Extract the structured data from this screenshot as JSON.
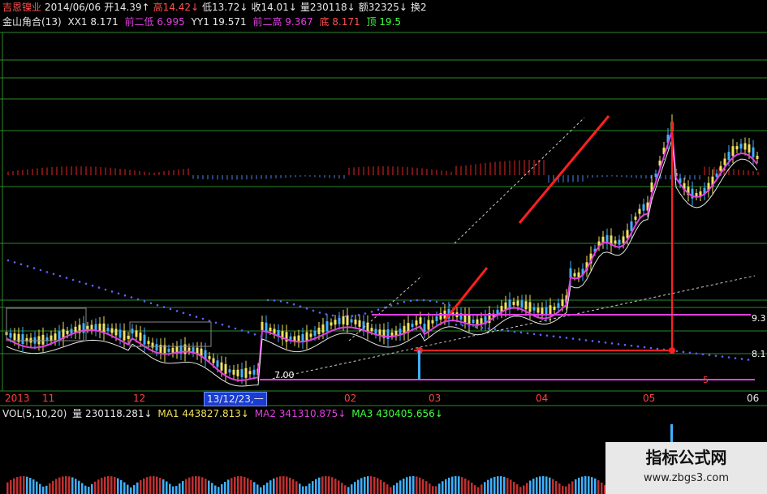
{
  "header": {
    "name": "吉恩镍业",
    "date": "2014/06/06",
    "open": "开14.39↑",
    "high": "高14.42↓",
    "low": "低13.72↓",
    "close": "收14.01↓",
    "volume": "量230118↓",
    "amount": "额32325↓",
    "turnover": "换2"
  },
  "indicator": {
    "name": "金山角合(13)",
    "xx1": "XX1 8.171",
    "prev_low": "前二低 6.995",
    "yy1": "YY1 19.571",
    "prev_high": "前二高 9.367",
    "bottom": "底 8.171",
    "top": "顶 19.5"
  },
  "price_labels": {
    "low_mark": "7.00",
    "right_93": "9.3",
    "right_81": "8.1",
    "right_5": "5"
  },
  "xaxis": {
    "labels": [
      "2013",
      "11",
      "12",
      "02",
      "03",
      "04",
      "05",
      "06"
    ],
    "selected": "13/12/23,一"
  },
  "volume_panel": {
    "title": "VOL(5,10,20)",
    "vol": "量 230118.281↓",
    "ma1": "MA1 443827.813↓",
    "ma2": "MA2 341310.875↓",
    "ma3": "MA3 430405.656↓"
  },
  "watermark": {
    "title": "指标公式网",
    "url": "www.zbgs3.com"
  },
  "colors": {
    "background": "#000000",
    "grid": "#2a8a2a",
    "up": "#f0e060",
    "down": "#40b0ff",
    "ma_white": "#e8e8e8",
    "ma_magenta": "#e040e0",
    "trend_red": "#ff2020"
  }
}
